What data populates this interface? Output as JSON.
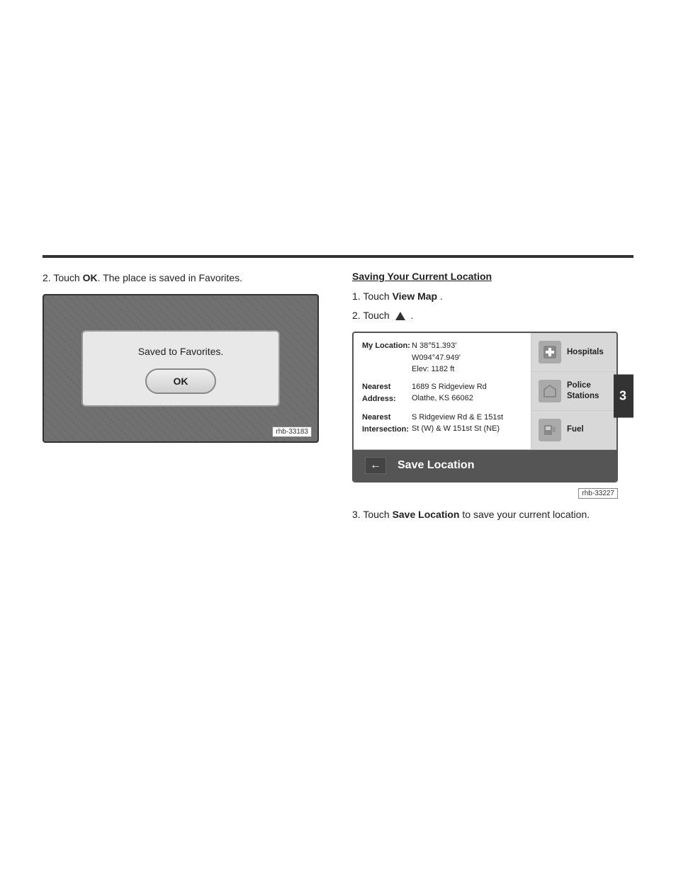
{
  "page": {
    "top_spacer_height": 320
  },
  "left_section": {
    "instruction": "2.  Touch ",
    "instruction_bold": "OK",
    "instruction_suffix": ". The place is saved in Favorites.",
    "dialog": {
      "message": "Saved to Favorites.",
      "ok_button_label": "OK"
    },
    "image_label": "rhb-33183"
  },
  "right_section": {
    "heading": "Saving Your Current Location",
    "steps": [
      {
        "number": "1.",
        "text": "Touch ",
        "bold": "View Map",
        "suffix": "."
      },
      {
        "number": "2.",
        "text": "Touch",
        "icon": "triangle",
        "suffix": "."
      }
    ],
    "device": {
      "my_location_label": "My Location:",
      "my_location_value": "N 38°51.393'\nW094°47.949'\nElev: 1182 ft",
      "nearest_address_label": "Nearest\nAddress:",
      "nearest_address_value": "1689 S Ridgeview Rd\nOlathe, KS 66062",
      "nearest_intersection_label": "Nearest\nIntersection:",
      "nearest_intersection_value": "S Ridgeview Rd & E 151st\nSt (W) & W 151st St (NE)",
      "poi_buttons": [
        {
          "label": "Hospitals",
          "icon": "🏥"
        },
        {
          "label": "Police\nStations",
          "icon": "🛡"
        },
        {
          "label": "Fuel",
          "icon": "⛽"
        }
      ],
      "save_location_label": "Save Location",
      "back_arrow": "←"
    },
    "image_label": "rhb-33227",
    "bottom_step": {
      "number": "3.",
      "text": "Touch ",
      "bold": "Save Location",
      "suffix": " to save your current location."
    }
  },
  "side_tab": {
    "label": "3"
  }
}
